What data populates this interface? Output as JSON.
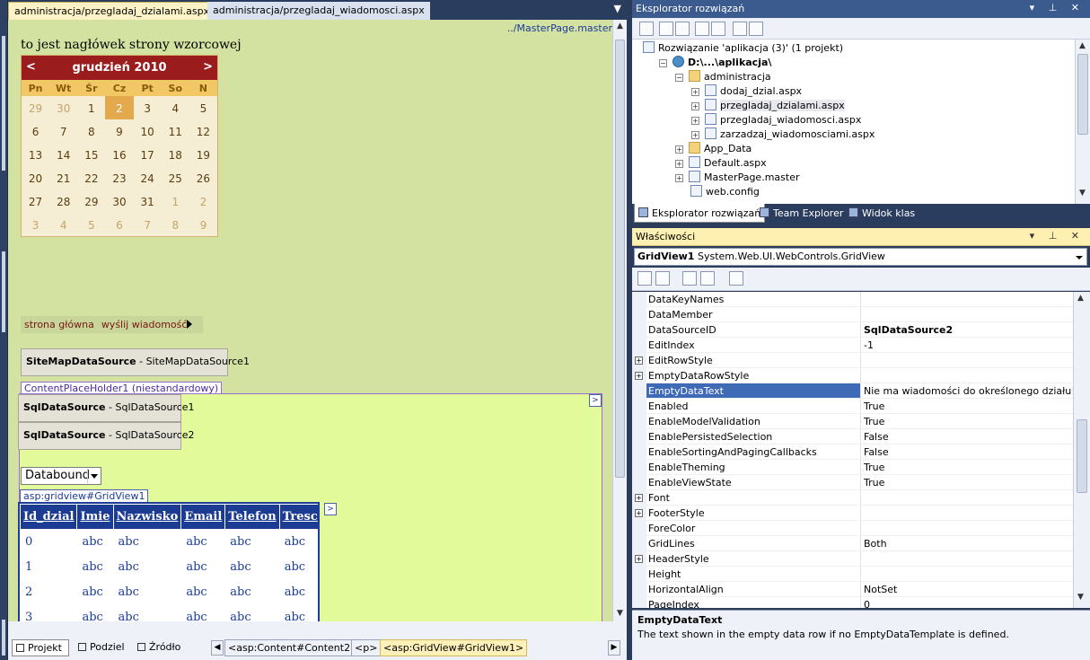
{
  "doc_tabs": [
    {
      "label": "administracja/przegladaj_dzialami.aspx",
      "active": true
    },
    {
      "label": "administracja/przegladaj_wiadomosci.aspx",
      "active": false
    }
  ],
  "editor": {
    "master_path": "../MasterPage.master",
    "master_header": "to jest nagłówek strony wzorcowej",
    "calendar": {
      "prev": "<",
      "next": ">",
      "month": "grudzień 2010",
      "days_of_week": [
        "Pn",
        "Wt",
        "Śr",
        "Cz",
        "Pt",
        "So",
        "N"
      ],
      "weeks": [
        [
          "29",
          "30",
          "1",
          "2",
          "3",
          "4",
          "5"
        ],
        [
          "6",
          "7",
          "8",
          "9",
          "10",
          "11",
          "12"
        ],
        [
          "13",
          "14",
          "15",
          "16",
          "17",
          "18",
          "19"
        ],
        [
          "20",
          "21",
          "22",
          "23",
          "24",
          "25",
          "26"
        ],
        [
          "27",
          "28",
          "29",
          "30",
          "31",
          "1",
          "2"
        ],
        [
          "3",
          "4",
          "5",
          "6",
          "7",
          "8",
          "9"
        ]
      ],
      "today": "2"
    },
    "menu": [
      "strona główna",
      "wyślij wiadomość"
    ],
    "sitemap_ds": {
      "type": "SiteMapDataSource",
      "name": " - SiteMapDataSource1"
    },
    "content_placeholder": "ContentPlaceHolder1 (niestandardowy)",
    "sql_ds": [
      {
        "type": "SqlDataSource",
        "name": " - SqlDataSource1"
      },
      {
        "type": "SqlDataSource",
        "name": " - SqlDataSource2"
      }
    ],
    "dropdown_value": "Databound",
    "gridview_label": "asp:gridview#GridView1",
    "grid": {
      "headers": [
        "Id_dzial",
        "Imie",
        "Nazwisko",
        "Email",
        "Telefon",
        "Tresc"
      ],
      "rows": [
        [
          "0",
          "abc",
          "abc",
          "abc",
          "abc",
          "abc"
        ],
        [
          "1",
          "abc",
          "abc",
          "abc",
          "abc",
          "abc"
        ],
        [
          "2",
          "abc",
          "abc",
          "abc",
          "abc",
          "abc"
        ],
        [
          "3",
          "abc",
          "abc",
          "abc",
          "abc",
          "abc"
        ]
      ]
    }
  },
  "bottom": {
    "view_tabs": [
      "Projekt",
      "Podziel",
      "Źródło"
    ],
    "breadcrumbs": [
      "<asp:Content#Content2>",
      "<p>",
      "<asp:GridView#GridView1>"
    ]
  },
  "solution_explorer": {
    "title": "Eksplorator rozwiązań",
    "tree": [
      {
        "label": "Rozwiązanie 'aplikacja (3)' (1 projekt)",
        "indent": 0,
        "expander": "",
        "icon": "solution-icon"
      },
      {
        "label": "D:\\...\\aplikacja\\",
        "indent": 1,
        "expander": "−",
        "icon": "web-project-icon",
        "bold": true
      },
      {
        "label": "administracja",
        "indent": 2,
        "expander": "−",
        "icon": "folder-open-icon"
      },
      {
        "label": "dodaj_dzial.aspx",
        "indent": 3,
        "expander": "+",
        "icon": "aspx-file-icon"
      },
      {
        "label": "przegladaj_dzialami.aspx",
        "indent": 3,
        "expander": "+",
        "icon": "aspx-file-icon",
        "selected": true
      },
      {
        "label": "przegladaj_wiadomosci.aspx",
        "indent": 3,
        "expander": "+",
        "icon": "aspx-file-icon"
      },
      {
        "label": "zarzadzaj_wiadomosciami.aspx",
        "indent": 3,
        "expander": "+",
        "icon": "aspx-file-icon"
      },
      {
        "label": "App_Data",
        "indent": 2,
        "expander": "+",
        "icon": "folder-icon"
      },
      {
        "label": "Default.aspx",
        "indent": 2,
        "expander": "+",
        "icon": "aspx-file-icon"
      },
      {
        "label": "MasterPage.master",
        "indent": 2,
        "expander": "+",
        "icon": "master-file-icon"
      },
      {
        "label": "web.config",
        "indent": 2,
        "expander": "",
        "icon": "config-file-icon"
      }
    ],
    "tabs": [
      "Eksplorator rozwiązań",
      "Team Explorer",
      "Widok klas"
    ]
  },
  "properties": {
    "title": "Właściwości",
    "object_name": "GridView1",
    "object_type": "System.Web.UI.WebControls.GridView",
    "rows": [
      {
        "name": "DataKeyNames",
        "value": "",
        "expander": ""
      },
      {
        "name": "DataMember",
        "value": "",
        "expander": ""
      },
      {
        "name": "DataSourceID",
        "value": "SqlDataSource2",
        "expander": "",
        "bold": true
      },
      {
        "name": "EditIndex",
        "value": "-1",
        "expander": ""
      },
      {
        "name": "EditRowStyle",
        "value": "",
        "expander": "+"
      },
      {
        "name": "EmptyDataRowStyle",
        "value": "",
        "expander": "+"
      },
      {
        "name": "EmptyDataText",
        "value": "Nie ma wiadomości do określonego działu!!!",
        "expander": "",
        "selected": true
      },
      {
        "name": "Enabled",
        "value": "True",
        "expander": ""
      },
      {
        "name": "EnableModelValidation",
        "value": "True",
        "expander": ""
      },
      {
        "name": "EnablePersistedSelection",
        "value": "False",
        "expander": ""
      },
      {
        "name": "EnableSortingAndPagingCallbacks",
        "value": "False",
        "expander": ""
      },
      {
        "name": "EnableTheming",
        "value": "True",
        "expander": ""
      },
      {
        "name": "EnableViewState",
        "value": "True",
        "expander": ""
      },
      {
        "name": "Font",
        "value": "",
        "expander": "+"
      },
      {
        "name": "FooterStyle",
        "value": "",
        "expander": "+"
      },
      {
        "name": "ForeColor",
        "value": "",
        "expander": ""
      },
      {
        "name": "GridLines",
        "value": "Both",
        "expander": ""
      },
      {
        "name": "HeaderStyle",
        "value": "",
        "expander": "+"
      },
      {
        "name": "Height",
        "value": "",
        "expander": ""
      },
      {
        "name": "HorizontalAlign",
        "value": "NotSet",
        "expander": ""
      },
      {
        "name": "PageIndex",
        "value": "0",
        "expander": ""
      }
    ],
    "desc_title": "EmptyDataText",
    "desc_text": "The text shown in the empty data row if no EmptyDataTemplate is defined."
  }
}
